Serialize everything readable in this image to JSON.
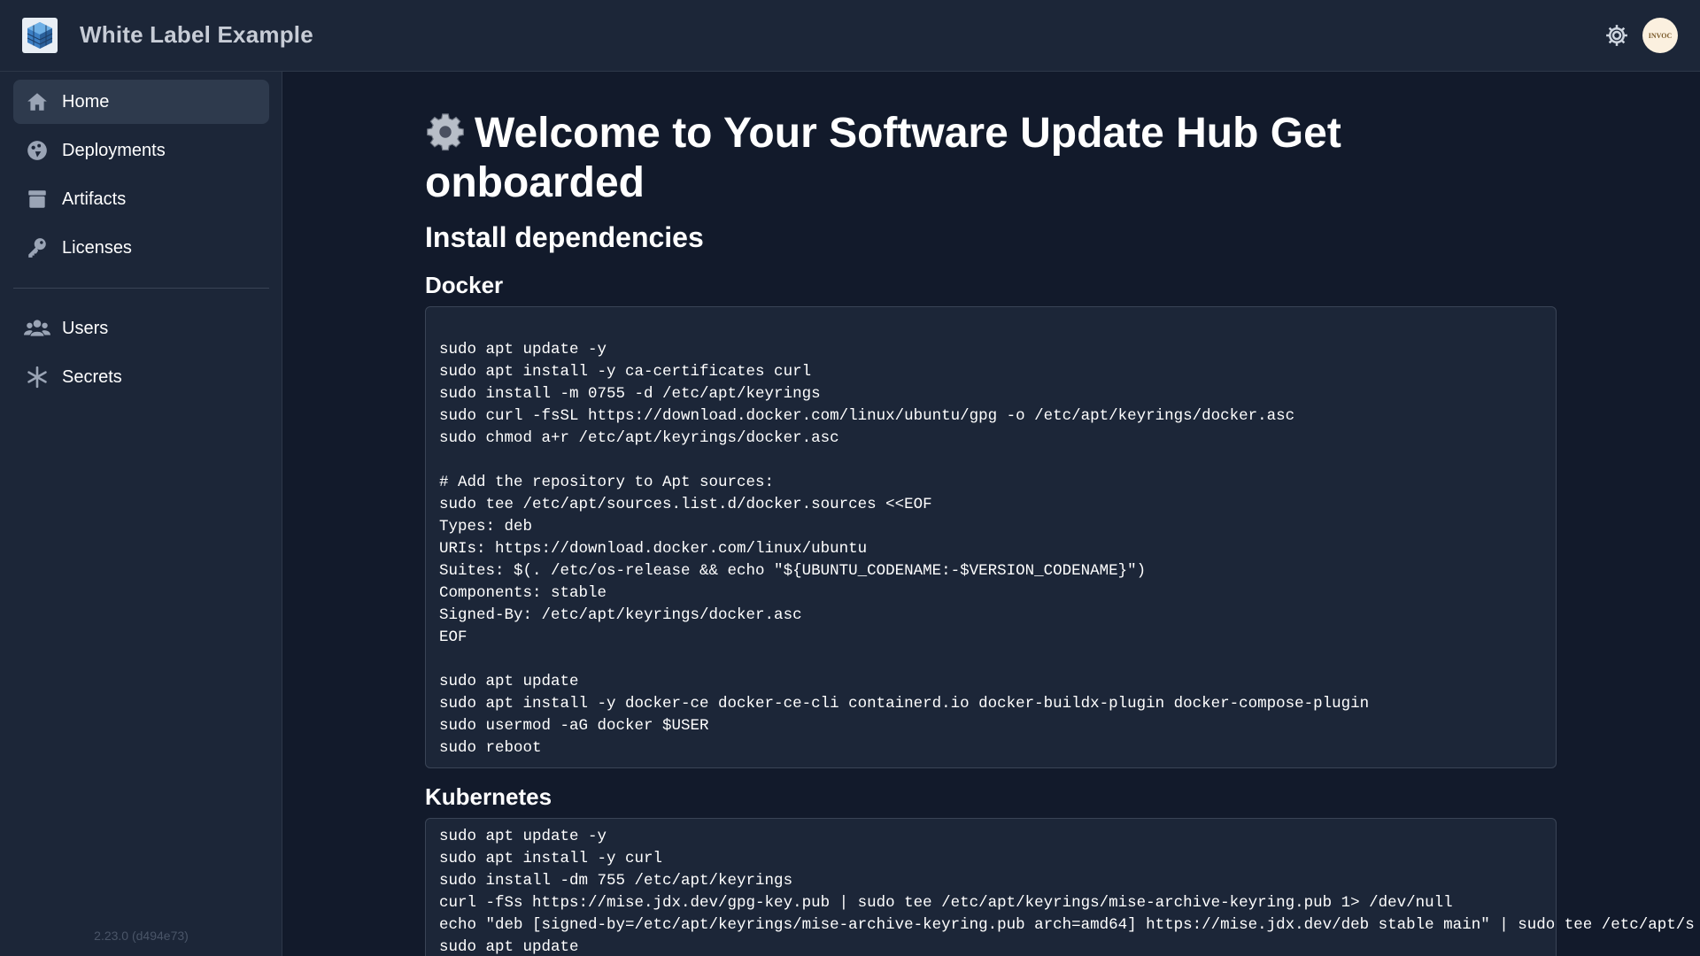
{
  "app": {
    "brand": "White Label Example",
    "version": "2.23.0 (d494e73)",
    "avatar_text": "INVOC"
  },
  "sidebar": {
    "items": [
      {
        "label": "Home",
        "icon": "home-icon",
        "active": true
      },
      {
        "label": "Deployments",
        "icon": "deployments-icon",
        "active": false
      },
      {
        "label": "Artifacts",
        "icon": "artifacts-icon",
        "active": false
      },
      {
        "label": "Licenses",
        "icon": "key-icon",
        "active": false
      },
      {
        "label": "Users",
        "icon": "users-icon",
        "active": false
      },
      {
        "label": "Secrets",
        "icon": "asterisk-icon",
        "active": false
      }
    ]
  },
  "main": {
    "title": "Welcome to Your Software Update Hub Get onboarded",
    "heading": "Install dependencies",
    "docker": {
      "heading": "Docker",
      "code": "sudo apt update -y\nsudo apt install -y ca-certificates curl\nsudo install -m 0755 -d /etc/apt/keyrings\nsudo curl -fsSL https://download.docker.com/linux/ubuntu/gpg -o /etc/apt/keyrings/docker.asc\nsudo chmod a+r /etc/apt/keyrings/docker.asc\n\n# Add the repository to Apt sources:\nsudo tee /etc/apt/sources.list.d/docker.sources <<EOF\nTypes: deb\nURIs: https://download.docker.com/linux/ubuntu\nSuites: $(. /etc/os-release && echo \"${UBUNTU_CODENAME:-$VERSION_CODENAME}\")\nComponents: stable\nSigned-By: /etc/apt/keyrings/docker.asc\nEOF\n\nsudo apt update\nsudo apt install -y docker-ce docker-ce-cli containerd.io docker-buildx-plugin docker-compose-plugin\nsudo usermod -aG docker $USER\nsudo reboot"
    },
    "kubernetes": {
      "heading": "Kubernetes",
      "code": "sudo apt update -y\nsudo apt install -y curl\nsudo install -dm 755 /etc/apt/keyrings\ncurl -fSs https://mise.jdx.dev/gpg-key.pub | sudo tee /etc/apt/keyrings/mise-archive-keyring.pub 1> /dev/null\necho \"deb [signed-by=/etc/apt/keyrings/mise-archive-keyring.pub arch=amd64] https://mise.jdx.dev/deb stable main\" | sudo tee /etc/apt/s\nsudo apt update"
    }
  },
  "colors": {
    "background": "#121a2b",
    "surface": "#1c2638",
    "active": "#2e3a4d",
    "border": "#3a4456",
    "brand_text": "#c7ccd6"
  }
}
